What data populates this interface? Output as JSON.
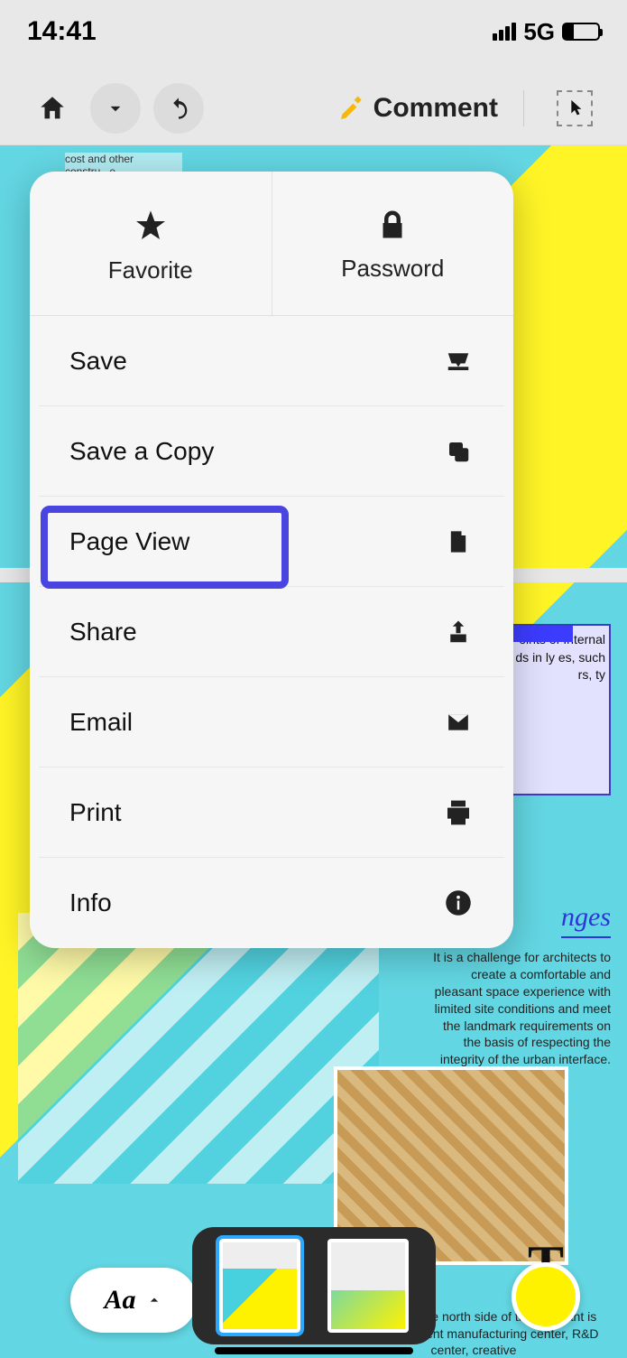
{
  "status": {
    "time": "14:41",
    "network": "5G"
  },
  "toolbar": {
    "comment": "Comment"
  },
  "menu": {
    "top": [
      {
        "label": "Favorite",
        "icon": "star-icon"
      },
      {
        "label": "Password",
        "icon": "lock-icon"
      }
    ],
    "items": [
      {
        "label": "Save",
        "icon": "inbox-icon"
      },
      {
        "label": "Save a Copy",
        "icon": "copy-icon"
      },
      {
        "label": "Page View",
        "icon": "page-icon"
      },
      {
        "label": "Share",
        "icon": "share-icon"
      },
      {
        "label": "Email",
        "icon": "mail-icon"
      },
      {
        "label": "Print",
        "icon": "print-icon"
      },
      {
        "label": "Info",
        "icon": "info-icon"
      }
    ]
  },
  "doc": {
    "snippet_top": "cost and other constru...e",
    "sidebox": "oints of Internal ds in ly es, such rs, ty",
    "heading2": "nges",
    "para2": "It is a challenge for architects to create a comfortable and pleasant space experience with limited site conditions and meet the landmark requirements on the basis of respecting the integrity of the urban interface.",
    "big_letter": "T",
    "plant": "The land on the north side of the old plant is odates intelligent manufacturing center, R&D center, creative"
  },
  "dock": {
    "aa": "Aa"
  }
}
